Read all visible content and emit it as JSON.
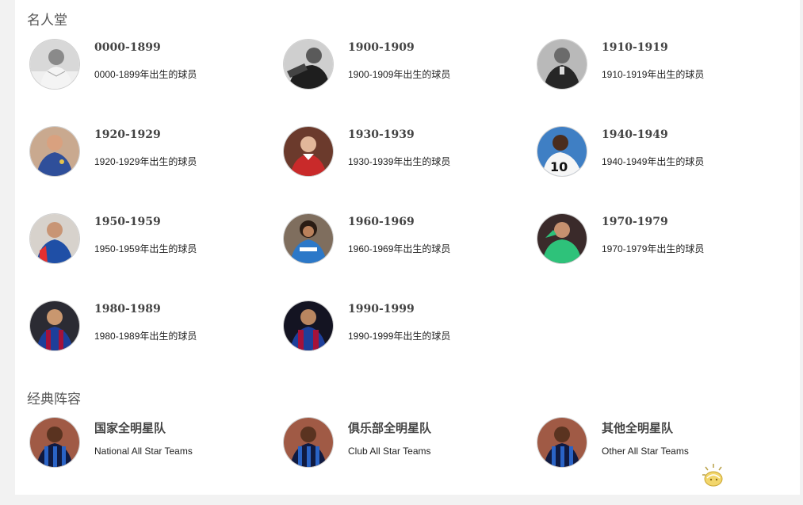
{
  "hall_of_fame": {
    "title": "名人堂",
    "items": [
      {
        "title": "0000-1899",
        "subtitle": "0000-1899年出生的球员",
        "avatar": "bw-player-icon"
      },
      {
        "title": "1900-1909",
        "subtitle": "1900-1909年出生的球员",
        "avatar": "bw-player-icon"
      },
      {
        "title": "1910-1919",
        "subtitle": "1910-1919年出生的球员",
        "avatar": "bw-player-icon"
      },
      {
        "title": "1920-1929",
        "subtitle": "1920-1929年出生的球员",
        "avatar": "player-icon"
      },
      {
        "title": "1930-1939",
        "subtitle": "1930-1939年出生的球员",
        "avatar": "player-icon"
      },
      {
        "title": "1940-1949",
        "subtitle": "1940-1949年出生的球员",
        "avatar": "player-icon"
      },
      {
        "title": "1950-1959",
        "subtitle": "1950-1959年出生的球员",
        "avatar": "player-icon"
      },
      {
        "title": "1960-1969",
        "subtitle": "1960-1969年出生的球员",
        "avatar": "player-icon"
      },
      {
        "title": "1970-1979",
        "subtitle": "1970-1979年出生的球员",
        "avatar": "player-icon"
      },
      {
        "title": "1980-1989",
        "subtitle": "1980-1989年出生的球员",
        "avatar": "player-icon"
      },
      {
        "title": "1990-1999",
        "subtitle": "1990-1999年出生的球员",
        "avatar": "player-icon"
      }
    ]
  },
  "classic_lineups": {
    "title": "经典阵容",
    "items": [
      {
        "title": "国家全明星队",
        "subtitle": "National All Star Teams",
        "avatar": "player-icon"
      },
      {
        "title": "俱乐部全明星队",
        "subtitle": "Club All Star Teams",
        "avatar": "player-icon"
      },
      {
        "title": "其他全明星队",
        "subtitle": "Other All Star Teams",
        "avatar": "player-icon"
      }
    ]
  },
  "colors": {
    "page_bg": "#f2f2f2",
    "panel_bg": "#ffffff",
    "title_text": "#444444",
    "sub_text": "#222222"
  }
}
